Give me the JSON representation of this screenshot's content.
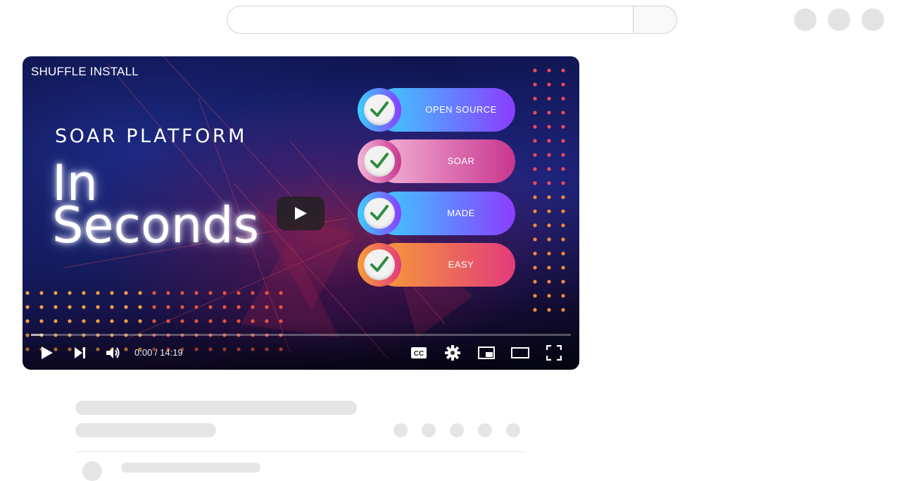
{
  "video": {
    "title": "SHUFFLE INSTALL",
    "thumbnail": {
      "heading": "SOAR PLATFORM",
      "big_line1": "In",
      "big_line2": "Seconds",
      "pills": [
        {
          "label": "OPEN SOURCE",
          "gradient": [
            "#3ad0ff",
            "#8a3dff"
          ]
        },
        {
          "label": "SOAR",
          "gradient": [
            "#f4b6d8",
            "#c8368f"
          ]
        },
        {
          "label": "MADE",
          "gradient": [
            "#3ad0ff",
            "#8a3dff"
          ]
        },
        {
          "label": "EASY",
          "gradient": [
            "#f6a037",
            "#e33a7b"
          ]
        }
      ]
    },
    "time_current": "0:00",
    "time_total": "14:19",
    "time_display": "0:00 / 14:19",
    "progress_fraction": 0.0
  },
  "icons": {
    "play": "play-icon",
    "next": "next-icon",
    "volume": "volume-icon",
    "captions": "cc-icon",
    "settings": "gear-icon",
    "miniplayer": "miniplayer-icon",
    "theater": "theater-icon",
    "fullscreen": "fullscreen-icon"
  },
  "colors": {
    "accent_check": "#2e8b3e",
    "skeleton": "#e5e5e5"
  }
}
